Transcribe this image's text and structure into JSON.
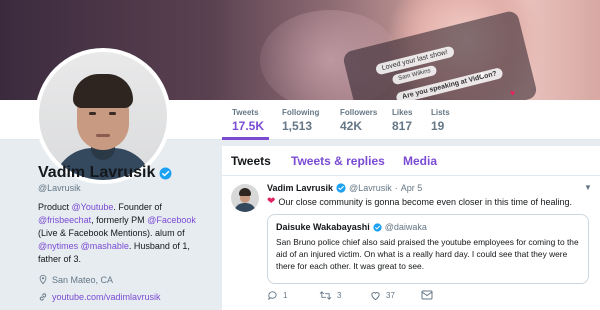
{
  "banner": {
    "bubble1": "Loved your last show!",
    "bubble2": "Sam Wilkins",
    "bubble3": "Are you speaking at VidCon?"
  },
  "stats": [
    {
      "label": "Tweets",
      "value": "17.5K"
    },
    {
      "label": "Following",
      "value": "1,513"
    },
    {
      "label": "Followers",
      "value": "42K"
    },
    {
      "label": "Likes",
      "value": "817"
    },
    {
      "label": "Lists",
      "value": "19"
    }
  ],
  "profile": {
    "name": "Vadim Lavrusik",
    "handle": "@Lavrusik",
    "bio": {
      "p1": "Product ",
      "l1": "@Youtube",
      "p2": ". Founder of ",
      "l2": "@frisbeechat",
      "p3": ", formerly PM ",
      "l3": "@Facebook",
      "p4": " (Live & Facebook Mentions). alum of ",
      "l4": "@nytimes",
      "p5": " ",
      "l5": "@mashable",
      "p6": ". Husband of 1, father of 3."
    },
    "location": "San Mateo, CA",
    "url": "youtube.com/vadimlavrusik"
  },
  "tabs": [
    "Tweets",
    "Tweets & replies",
    "Media"
  ],
  "tweet": {
    "name": "Vadim Lavrusik",
    "handle": "@Lavrusik",
    "sep": "·",
    "date": "Apr 5",
    "text": "Our close community is gonna become even closer in this time of healing.",
    "quote": {
      "name": "Daisuke Wakabayashi",
      "handle": "@daiwaka",
      "text": "San Bruno police chief also said praised the youtube employees for coming to the aid of an injured victim. On what is a really hard day. I could see that they were there for each other. It was great to see."
    },
    "actions": {
      "reply": "1",
      "retweet": "3",
      "like": "37"
    }
  },
  "colors": {
    "accent": "#7b4bd4",
    "verified": "#1da1f2",
    "heart": "#e0245e",
    "muted": "#657786"
  }
}
